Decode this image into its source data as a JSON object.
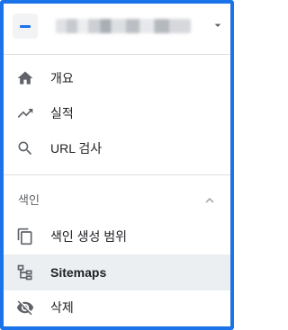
{
  "property": {
    "name": "",
    "icon": "property-icon",
    "dropdown_icon": "chevron-down-icon"
  },
  "nav_top": [
    {
      "label": "개요",
      "icon": "home-icon"
    },
    {
      "label": "실적",
      "icon": "trending-up-icon"
    },
    {
      "label": "URL 검사",
      "icon": "search-icon"
    }
  ],
  "index_section": {
    "label": "색인",
    "toggle_icon": "chevron-up-icon",
    "items": [
      {
        "label": "색인 생성 범위",
        "icon": "coverage-icon"
      },
      {
        "label": "Sitemaps",
        "icon": "sitemap-icon",
        "selected": true
      },
      {
        "label": "삭제",
        "icon": "visibility-off-icon"
      }
    ]
  },
  "colors": {
    "accent": "#1a73e8",
    "selected_bg": "#eceff1",
    "icon": "#5f6368",
    "text": "#202124"
  }
}
